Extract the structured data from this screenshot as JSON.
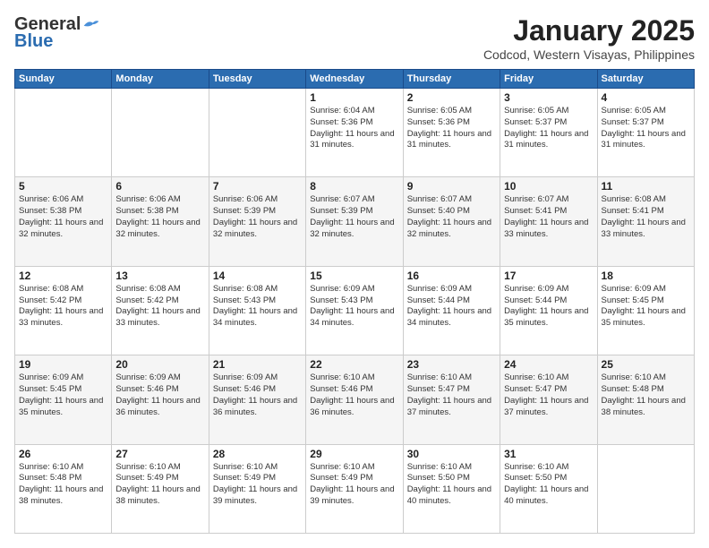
{
  "header": {
    "logo_general": "General",
    "logo_blue": "Blue",
    "month": "January 2025",
    "location": "Codcod, Western Visayas, Philippines"
  },
  "weekdays": [
    "Sunday",
    "Monday",
    "Tuesday",
    "Wednesday",
    "Thursday",
    "Friday",
    "Saturday"
  ],
  "weeks": [
    [
      {
        "day": "",
        "info": ""
      },
      {
        "day": "",
        "info": ""
      },
      {
        "day": "",
        "info": ""
      },
      {
        "day": "1",
        "info": "Sunrise: 6:04 AM\nSunset: 5:36 PM\nDaylight: 11 hours\nand 31 minutes."
      },
      {
        "day": "2",
        "info": "Sunrise: 6:05 AM\nSunset: 5:36 PM\nDaylight: 11 hours\nand 31 minutes."
      },
      {
        "day": "3",
        "info": "Sunrise: 6:05 AM\nSunset: 5:37 PM\nDaylight: 11 hours\nand 31 minutes."
      },
      {
        "day": "4",
        "info": "Sunrise: 6:05 AM\nSunset: 5:37 PM\nDaylight: 11 hours\nand 31 minutes."
      }
    ],
    [
      {
        "day": "5",
        "info": "Sunrise: 6:06 AM\nSunset: 5:38 PM\nDaylight: 11 hours\nand 32 minutes."
      },
      {
        "day": "6",
        "info": "Sunrise: 6:06 AM\nSunset: 5:38 PM\nDaylight: 11 hours\nand 32 minutes."
      },
      {
        "day": "7",
        "info": "Sunrise: 6:06 AM\nSunset: 5:39 PM\nDaylight: 11 hours\nand 32 minutes."
      },
      {
        "day": "8",
        "info": "Sunrise: 6:07 AM\nSunset: 5:39 PM\nDaylight: 11 hours\nand 32 minutes."
      },
      {
        "day": "9",
        "info": "Sunrise: 6:07 AM\nSunset: 5:40 PM\nDaylight: 11 hours\nand 32 minutes."
      },
      {
        "day": "10",
        "info": "Sunrise: 6:07 AM\nSunset: 5:41 PM\nDaylight: 11 hours\nand 33 minutes."
      },
      {
        "day": "11",
        "info": "Sunrise: 6:08 AM\nSunset: 5:41 PM\nDaylight: 11 hours\nand 33 minutes."
      }
    ],
    [
      {
        "day": "12",
        "info": "Sunrise: 6:08 AM\nSunset: 5:42 PM\nDaylight: 11 hours\nand 33 minutes."
      },
      {
        "day": "13",
        "info": "Sunrise: 6:08 AM\nSunset: 5:42 PM\nDaylight: 11 hours\nand 33 minutes."
      },
      {
        "day": "14",
        "info": "Sunrise: 6:08 AM\nSunset: 5:43 PM\nDaylight: 11 hours\nand 34 minutes."
      },
      {
        "day": "15",
        "info": "Sunrise: 6:09 AM\nSunset: 5:43 PM\nDaylight: 11 hours\nand 34 minutes."
      },
      {
        "day": "16",
        "info": "Sunrise: 6:09 AM\nSunset: 5:44 PM\nDaylight: 11 hours\nand 34 minutes."
      },
      {
        "day": "17",
        "info": "Sunrise: 6:09 AM\nSunset: 5:44 PM\nDaylight: 11 hours\nand 35 minutes."
      },
      {
        "day": "18",
        "info": "Sunrise: 6:09 AM\nSunset: 5:45 PM\nDaylight: 11 hours\nand 35 minutes."
      }
    ],
    [
      {
        "day": "19",
        "info": "Sunrise: 6:09 AM\nSunset: 5:45 PM\nDaylight: 11 hours\nand 35 minutes."
      },
      {
        "day": "20",
        "info": "Sunrise: 6:09 AM\nSunset: 5:46 PM\nDaylight: 11 hours\nand 36 minutes."
      },
      {
        "day": "21",
        "info": "Sunrise: 6:09 AM\nSunset: 5:46 PM\nDaylight: 11 hours\nand 36 minutes."
      },
      {
        "day": "22",
        "info": "Sunrise: 6:10 AM\nSunset: 5:46 PM\nDaylight: 11 hours\nand 36 minutes."
      },
      {
        "day": "23",
        "info": "Sunrise: 6:10 AM\nSunset: 5:47 PM\nDaylight: 11 hours\nand 37 minutes."
      },
      {
        "day": "24",
        "info": "Sunrise: 6:10 AM\nSunset: 5:47 PM\nDaylight: 11 hours\nand 37 minutes."
      },
      {
        "day": "25",
        "info": "Sunrise: 6:10 AM\nSunset: 5:48 PM\nDaylight: 11 hours\nand 38 minutes."
      }
    ],
    [
      {
        "day": "26",
        "info": "Sunrise: 6:10 AM\nSunset: 5:48 PM\nDaylight: 11 hours\nand 38 minutes."
      },
      {
        "day": "27",
        "info": "Sunrise: 6:10 AM\nSunset: 5:49 PM\nDaylight: 11 hours\nand 38 minutes."
      },
      {
        "day": "28",
        "info": "Sunrise: 6:10 AM\nSunset: 5:49 PM\nDaylight: 11 hours\nand 39 minutes."
      },
      {
        "day": "29",
        "info": "Sunrise: 6:10 AM\nSunset: 5:49 PM\nDaylight: 11 hours\nand 39 minutes."
      },
      {
        "day": "30",
        "info": "Sunrise: 6:10 AM\nSunset: 5:50 PM\nDaylight: 11 hours\nand 40 minutes."
      },
      {
        "day": "31",
        "info": "Sunrise: 6:10 AM\nSunset: 5:50 PM\nDaylight: 11 hours\nand 40 minutes."
      },
      {
        "day": "",
        "info": ""
      }
    ]
  ]
}
